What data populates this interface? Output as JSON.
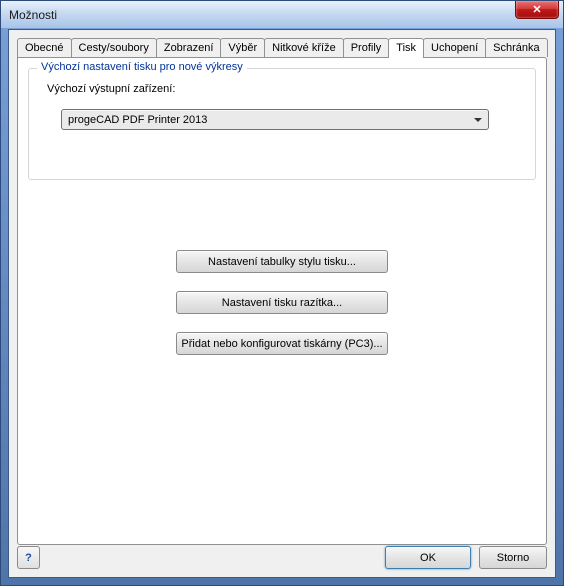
{
  "window": {
    "title": "Možnosti"
  },
  "tabs": {
    "items": [
      {
        "label": "Obecné"
      },
      {
        "label": "Cesty/soubory"
      },
      {
        "label": "Zobrazení"
      },
      {
        "label": "Výběr"
      },
      {
        "label": "Nitkové kříže"
      },
      {
        "label": "Profily"
      },
      {
        "label": "Tisk"
      },
      {
        "label": "Uchopení"
      },
      {
        "label": "Schránka"
      }
    ],
    "active_index": 6
  },
  "panel": {
    "group_title": "Výchozí nastavení tisku pro nové výkresy",
    "device_label": "Výchozí výstupní zařízení:",
    "device_value": "progeCAD PDF Printer 2013",
    "btn_style_tables": "Nastavení tabulky stylu tisku...",
    "btn_stamp": "Nastavení tisku razítka...",
    "btn_printers": "Přidat nebo konfigurovat tiskárny (PC3)..."
  },
  "buttons": {
    "help": "?",
    "ok": "OK",
    "cancel": "Storno"
  },
  "close_icon": "✕"
}
